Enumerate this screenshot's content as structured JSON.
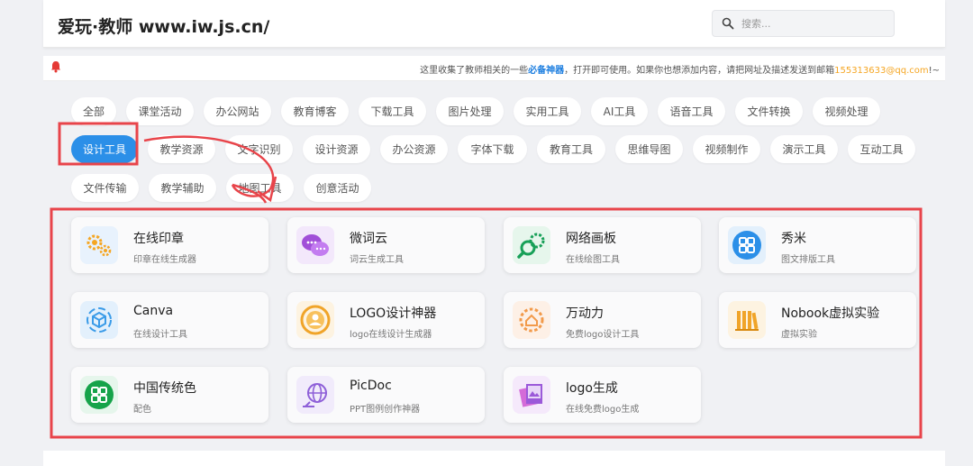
{
  "header": {
    "site_title": "爱玩·教师 www.iw.js.cn/",
    "search_placeholder": "搜索..."
  },
  "notice": {
    "text_before": "这里收集了教师相关的一些",
    "highlight": "必备神器",
    "text_middle": "，打开即可使用。如果你也想添加内容，请把网址及描述发送到邮箱",
    "email": "155313633@qq.com",
    "text_after": "!~"
  },
  "categories": [
    "全部",
    "课堂活动",
    "办公网站",
    "教育博客",
    "下载工具",
    "图片处理",
    "实用工具",
    "AI工具",
    "语音工具",
    "文件转换",
    "视频处理",
    "设计工具",
    "教学资源",
    "文字识别",
    "设计资源",
    "办公资源",
    "字体下载",
    "教育工具",
    "思维导图",
    "视频制作",
    "演示工具",
    "互动工具",
    "文件传输",
    "教学辅助",
    "地图工具",
    "创意活动"
  ],
  "active_category": "设计工具",
  "tools": [
    {
      "name": "在线印章",
      "desc": "印章在线生成器",
      "icon": "gears-icon"
    },
    {
      "name": "微词云",
      "desc": "词云生成工具",
      "icon": "chat-bubbles-icon"
    },
    {
      "name": "网络画板",
      "desc": "在线绘图工具",
      "icon": "gear-magnifier-icon"
    },
    {
      "name": "秀米",
      "desc": "图文排版工具",
      "icon": "grid-icon"
    },
    {
      "name": "Canva",
      "desc": "在线设计工具",
      "icon": "cube-cycle-icon"
    },
    {
      "name": "LOGO设计神器",
      "desc": "logo在线设计生成器",
      "icon": "graduate-badge-icon"
    },
    {
      "name": "万动力",
      "desc": "免费logo设计工具",
      "icon": "gear-home-icon"
    },
    {
      "name": "Nobook虚拟实验",
      "desc": "虚拟实验",
      "icon": "books-icon"
    },
    {
      "name": "中国传统色",
      "desc": "配色",
      "icon": "color-grid-icon"
    },
    {
      "name": "PicDoc",
      "desc": "PPT图例创作神器",
      "icon": "globe-icon"
    },
    {
      "name": "logo生成",
      "desc": "在线免费logo生成",
      "icon": "photo-stack-icon"
    }
  ],
  "colors": {
    "accent": "#2b8fe8",
    "annotation": "#e8444a",
    "email": "#f5a623"
  }
}
